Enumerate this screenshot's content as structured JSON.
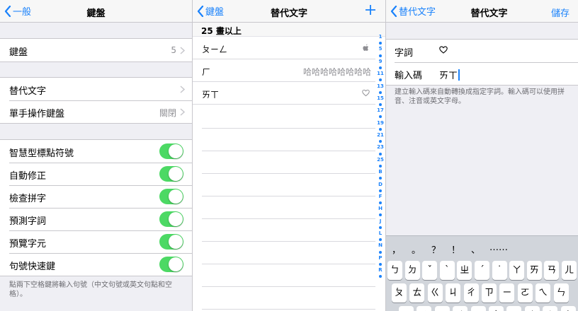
{
  "panel1": {
    "nav": {
      "back_label": "一般",
      "title": "鍵盤"
    },
    "rows_group1": [
      {
        "label": "鍵盤",
        "value": "5"
      }
    ],
    "rows_group2": [
      {
        "label": "替代文字",
        "value": ""
      },
      {
        "label": "單手操作鍵盤",
        "value": "關閉"
      }
    ],
    "toggles": [
      {
        "label": "智慧型標點符號",
        "on": true
      },
      {
        "label": "自動修正",
        "on": true
      },
      {
        "label": "檢查拼字",
        "on": true
      },
      {
        "label": "預測字詞",
        "on": true
      },
      {
        "label": "預覽字元",
        "on": true
      },
      {
        "label": "句號快速鍵",
        "on": true
      }
    ],
    "footnote": "點兩下空格鍵將輸入句號（中文句號或英文句點和空格）。"
  },
  "panel2": {
    "nav": {
      "back_label": "鍵盤",
      "title": "替代文字"
    },
    "section_header": "25 畫以上",
    "items": [
      {
        "shortcut": "ㄆㄧㄥ",
        "phrase_icon": "apple-logo-icon"
      },
      {
        "shortcut": "ㄏ",
        "phrase": "哈哈哈哈哈哈哈哈"
      },
      {
        "shortcut": "ㄞㄒ",
        "phrase_icon": "heart-icon"
      }
    ],
    "index": [
      "1",
      "•",
      "5",
      "•",
      "9",
      "•",
      "11",
      "•",
      "13",
      "•",
      "15",
      "•",
      "17",
      "•",
      "19",
      "•",
      "21",
      "•",
      "23",
      "•",
      "25",
      "•",
      "B",
      "•",
      "D",
      "•",
      "F",
      "•",
      "H",
      "•",
      "J",
      "•",
      "L",
      "•",
      "N",
      "•",
      "P",
      "•",
      "R",
      "•"
    ]
  },
  "panel3": {
    "nav": {
      "back_label": "替代文字",
      "title": "替代文字",
      "save_label": "儲存"
    },
    "fields": [
      {
        "label": "字詞",
        "value_icon": "heart-icon"
      },
      {
        "label": "輸入碼",
        "value": "ㄞㄒ"
      }
    ],
    "footnote": "建立輸入碼來自動轉換成指定字詞。輸入碼可以使用拼音、注音或英文字母。",
    "keyboard": {
      "candidates": [
        "，",
        "。",
        "？",
        "！",
        "、",
        "……"
      ],
      "row1": [
        "ㄅ",
        "ㄉ",
        "ˇ",
        "ˋ",
        "ㄓ",
        "ˊ",
        "˙",
        "ㄚ",
        "ㄞ",
        "ㄢ",
        "ㄦ"
      ],
      "row2": [
        "ㄆ",
        "ㄊ",
        "ㄍ",
        "ㄐ",
        "ㄔ",
        "ㄗ",
        "ㄧ",
        "ㄛ",
        "ㄟ",
        "ㄣ"
      ],
      "row3": [
        "ㄇ",
        "ㄋ",
        "ㄎ",
        "ㄑ",
        "ㄕ",
        "ㄘ",
        "ㄨ",
        "ㄜ",
        "ㄠ",
        "ㄤ"
      ]
    }
  },
  "colors": {
    "accent": "#1a82fb",
    "toggle_on": "#4cd964",
    "group_bg": "#efeff4"
  }
}
